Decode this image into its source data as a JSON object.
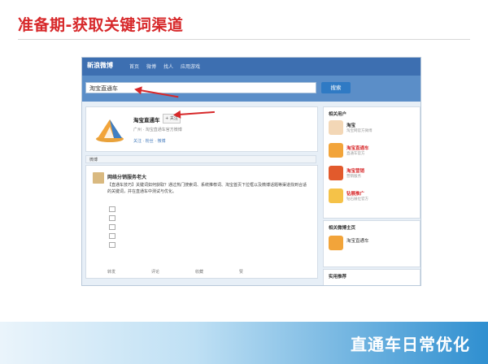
{
  "slide": {
    "title": "准备期-获取关键词渠道",
    "footer": "直通车日常优化"
  },
  "weibo": {
    "logo": "新浪微博",
    "nav": [
      "首页",
      "微博",
      "找人",
      "应用游戏"
    ],
    "search_value": "淘宝直通车",
    "search_button": "搜索",
    "profile": {
      "name": "淘宝直通车",
      "follow_label": "+ 关注",
      "meta": "广州 · 淘宝直通车官方微博",
      "stats": "关注 · 粉丝 · 微博"
    },
    "section": "微博",
    "post": {
      "author": "网络分销服务老大",
      "body": "【直通车技巧】关键词如何获取？通过热门搜索词、系统推荐词、淘宝首页下拉框以及微博话题等渠道找到合适的关键词，并在直通车中测试与优化。",
      "actions": [
        "转发",
        "评论",
        "收藏",
        "赞"
      ]
    },
    "sidebar": {
      "title": "相关用户",
      "items": [
        {
          "name": "淘宝",
          "desc": "淘宝网官方微博"
        },
        {
          "name": "淘宝直通车",
          "desc": "直通车官方"
        },
        {
          "name": "淘宝营销",
          "desc": "营销服务"
        },
        {
          "name": "钻展推广",
          "desc": "钻石展位官方"
        }
      ]
    },
    "sidebar2": {
      "title": "相关微博主页",
      "name": "淘宝直通车"
    },
    "sidebar3": {
      "title": "实用推荐"
    }
  },
  "colors": {
    "accent_red": "#d7282a",
    "weibo_blue": "#3d6fb1"
  }
}
